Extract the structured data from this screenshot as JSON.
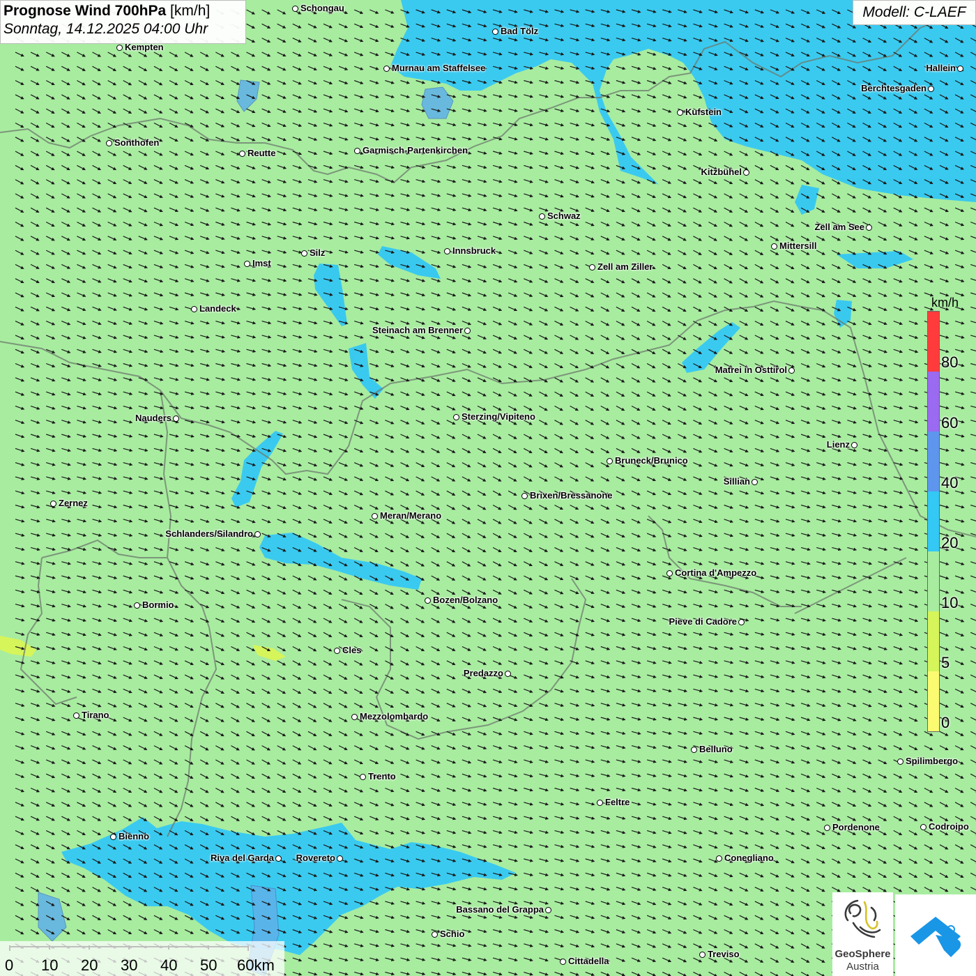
{
  "header": {
    "title_bold": "Prognose Wind 700hPa",
    "title_unit": "[km/h]",
    "datetime": "Sonntag, 14.12.2025 04:00 Uhr"
  },
  "model_label": "Modell: C-LAEF",
  "legend": {
    "unit": "km/h",
    "labels": [
      "80",
      "60",
      "40",
      "20",
      "10",
      "5",
      "0"
    ],
    "colors": [
      "#ff3b3b",
      "#9a6af0",
      "#5e96ee",
      "#34c8f4",
      "#a8eca0",
      "#d6f55a",
      "#fbfb72"
    ]
  },
  "scale": {
    "labels": [
      "0",
      "10",
      "20",
      "30",
      "40",
      "50",
      "60km"
    ]
  },
  "logo": {
    "name_line1": "GeoSphere",
    "name_line2": "Austria"
  },
  "map": {
    "base_color": "#a8eca0",
    "wind_color": "#34c8f4",
    "arrow_direction": "west-northwest flow toward east-southeast",
    "cities": [
      {
        "name": "Schongau"
      },
      {
        "name": "Bad Tölz"
      },
      {
        "name": "Kempten"
      },
      {
        "name": "Murnau am Staffelsee"
      },
      {
        "name": "Hallein"
      },
      {
        "name": "Berchtesgaden"
      },
      {
        "name": "Kufstein"
      },
      {
        "name": "Sonthofen"
      },
      {
        "name": "Reutte"
      },
      {
        "name": "Garmisch-Partenkirchen"
      },
      {
        "name": "Kitzbühel"
      },
      {
        "name": "Schwaz"
      },
      {
        "name": "Zell am See"
      },
      {
        "name": "Mittersill"
      },
      {
        "name": "Silz"
      },
      {
        "name": "Innsbruck"
      },
      {
        "name": "Imst"
      },
      {
        "name": "Zell am Ziller"
      },
      {
        "name": "Landeck"
      },
      {
        "name": "Steinach am Brenner"
      },
      {
        "name": "Matrei in Osttirol"
      },
      {
        "name": "Nauders"
      },
      {
        "name": "Sterzing/Vipiteno"
      },
      {
        "name": "Lienz"
      },
      {
        "name": "Bruneck/Brunico"
      },
      {
        "name": "Sillian"
      },
      {
        "name": "Brixen/Bressanone"
      },
      {
        "name": "Zernez"
      },
      {
        "name": "Meran/Merano"
      },
      {
        "name": "Schlanders/Silandro"
      },
      {
        "name": "Cortina d'Ampezzo"
      },
      {
        "name": "Bozen/Bolzano"
      },
      {
        "name": "Bormio"
      },
      {
        "name": "Pieve di Cadore"
      },
      {
        "name": "Cles"
      },
      {
        "name": "Predazzo"
      },
      {
        "name": "Tirano"
      },
      {
        "name": "Mezzolombardo"
      },
      {
        "name": "Belluno"
      },
      {
        "name": "Spilimbergo"
      },
      {
        "name": "Trento"
      },
      {
        "name": "Feltre"
      },
      {
        "name": "Pordenone"
      },
      {
        "name": "Codroipo"
      },
      {
        "name": "Bienno"
      },
      {
        "name": "Riva del Garda"
      },
      {
        "name": "Rovereto"
      },
      {
        "name": "Conegliano"
      },
      {
        "name": "Bassano del Grappa"
      },
      {
        "name": "Schio"
      },
      {
        "name": "Treviso"
      },
      {
        "name": "Cittadella"
      }
    ]
  }
}
